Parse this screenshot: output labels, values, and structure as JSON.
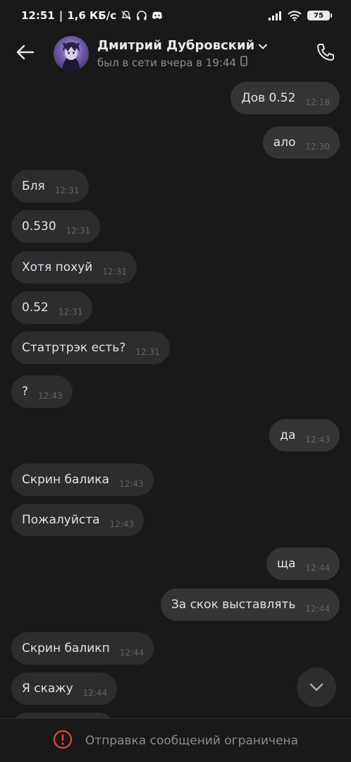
{
  "status_bar": {
    "time": "12:51",
    "speed": "1,6 КБ/с",
    "battery": "75"
  },
  "header": {
    "contact_name": "Дмитрий Дубровский",
    "last_seen": "был в сети вчера в 19:44"
  },
  "messages": [
    {
      "direction": "out",
      "text": "Дов 0.52",
      "time": "12:18"
    },
    {
      "direction": "out",
      "text": "ало",
      "time": "12:30"
    },
    {
      "direction": "in",
      "text": "Бля",
      "time": "12:31"
    },
    {
      "direction": "in",
      "text": "0.530",
      "time": "12:31"
    },
    {
      "direction": "in",
      "text": "Хотя похуй",
      "time": "12:31"
    },
    {
      "direction": "in",
      "text": "0.52",
      "time": "12:31"
    },
    {
      "direction": "in",
      "text": "Статртрэк есть?",
      "time": "12:31"
    },
    {
      "direction": "in",
      "text": "?",
      "time": "12:43"
    },
    {
      "direction": "out",
      "text": "да",
      "time": "12:43"
    },
    {
      "direction": "in",
      "text": "Скрин балика",
      "time": "12:43"
    },
    {
      "direction": "in",
      "text": "Пожалуйста",
      "time": "12:43"
    },
    {
      "direction": "out",
      "text": "ща",
      "time": "12:44"
    },
    {
      "direction": "out",
      "text": "За скок выставлять",
      "time": "12:44"
    },
    {
      "direction": "in",
      "text": "Скрин баликп",
      "time": "12:44"
    },
    {
      "direction": "in",
      "text": "Я скажу",
      "time": "12:44"
    }
  ],
  "bottom_bar": {
    "restricted_text": "Отправка сообщений ограничена"
  },
  "colors": {
    "background": "#19191a",
    "bubble_in": "#2c2d2e",
    "bubble_out": "#333435",
    "warning": "#e64646"
  }
}
